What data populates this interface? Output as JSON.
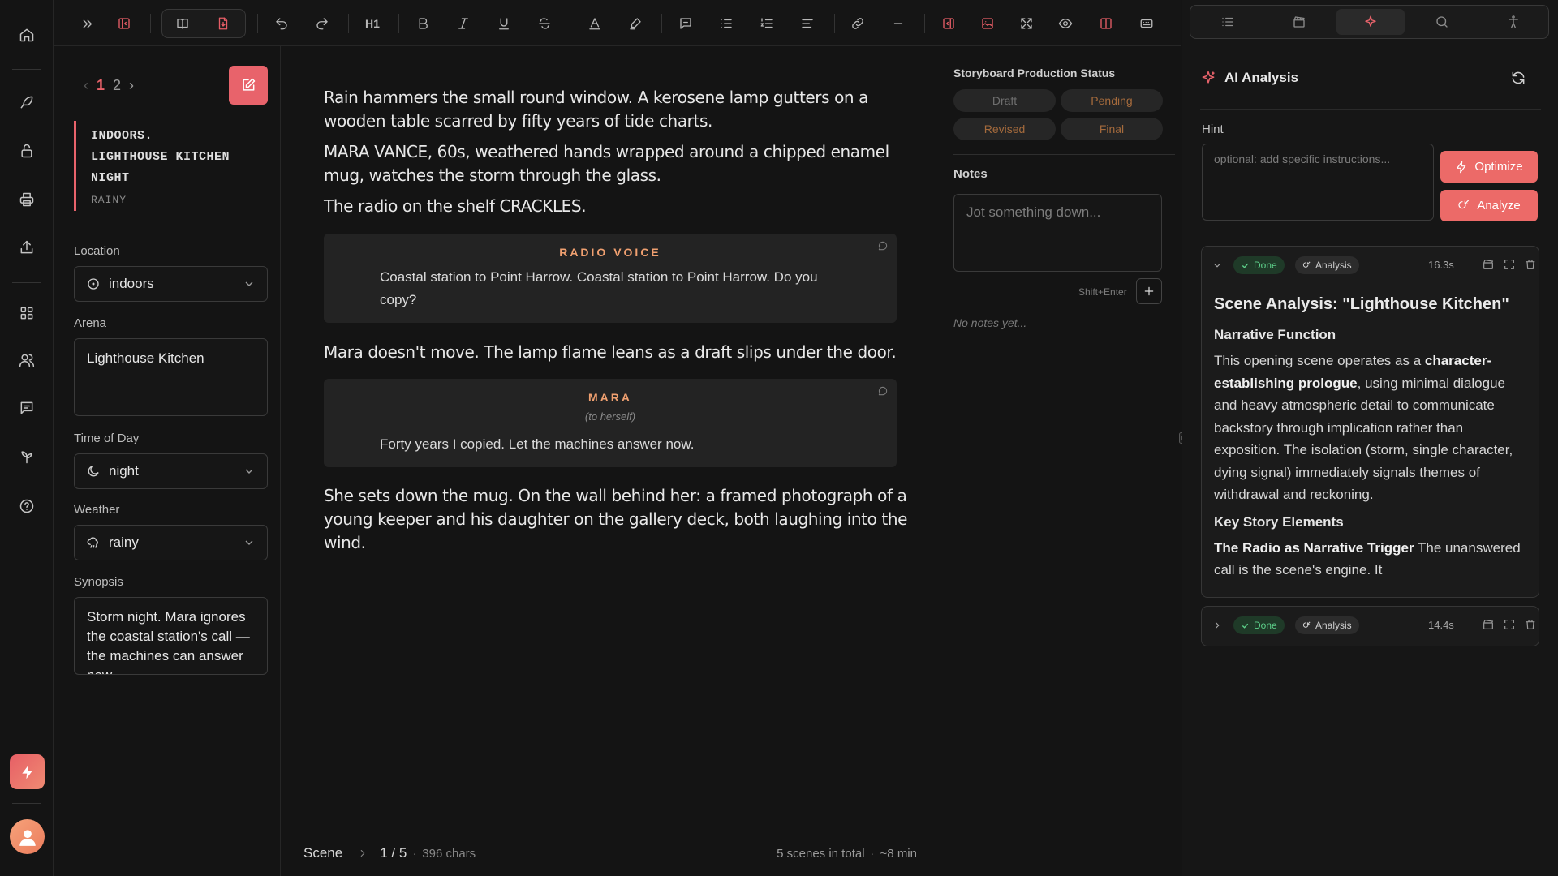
{
  "rail": {
    "items": [
      {
        "icon": "home-icon"
      },
      {
        "icon": "feather-icon"
      },
      {
        "icon": "lock-icon"
      },
      {
        "icon": "printer-icon"
      },
      {
        "icon": "share-icon"
      },
      {
        "icon": "grid-icon"
      },
      {
        "icon": "users-icon"
      },
      {
        "icon": "message-icon"
      },
      {
        "icon": "sprout-icon"
      },
      {
        "icon": "help-icon"
      }
    ],
    "quick_action_icon": "bolt-icon",
    "avatar_icon": "user-avatar-icon"
  },
  "toolbar": {
    "heading_label": "H1",
    "icons": [
      "expand-icon",
      "sidebar-toggle-icon",
      "book-icon",
      "file-icon",
      "undo-icon",
      "redo-icon",
      "h1-icon",
      "bold-icon",
      "italic-icon",
      "underline-icon",
      "strikethrough-icon",
      "text-color-icon",
      "highlighter-icon",
      "comment-icon",
      "bullet-list-icon",
      "numbered-list-icon",
      "align-icon",
      "link-icon",
      "divider-icon",
      "panel-left-icon",
      "image-icon",
      "fullscreen-icon",
      "preview-icon",
      "split-view-icon",
      "keyboard-icon"
    ]
  },
  "scene_nav": {
    "pages": [
      "1",
      "2"
    ],
    "current_page": "1"
  },
  "scene_heading": {
    "lines": [
      "INDOORS.",
      "LIGHTHOUSE KITCHEN",
      "NIGHT"
    ],
    "weather": "RAINY"
  },
  "fields": {
    "location": {
      "label": "Location",
      "value": "indoors"
    },
    "arena": {
      "label": "Arena",
      "value": "Lighthouse Kitchen"
    },
    "time_of_day": {
      "label": "Time of Day",
      "value": "night"
    },
    "weather": {
      "label": "Weather",
      "value": "rainy"
    },
    "synopsis": {
      "label": "Synopsis",
      "value": "Storm night. Mara ignores the coastal station's call — the machines can answer now."
    }
  },
  "script": {
    "p1": "Rain hammers the small round window. A kerosene lamp gutters on a wooden table scarred by fifty years of tide charts.",
    "p2": "MARA VANCE, 60s, weathered hands wrapped around a chipped enamel mug, watches the storm through the glass.",
    "p3": "The radio on the shelf CRACKLES.",
    "d1": {
      "character": "RADIO VOICE",
      "line": "Coastal station to Point Harrow. Coastal station to Point Harrow. Do you copy?"
    },
    "p4": "Mara doesn't move. The lamp flame leans as a draft slips under the door.",
    "d2": {
      "character": "MARA",
      "parenthetical": "(to herself)",
      "line": "Forty years I copied. Let the machines answer now."
    },
    "p5": "She sets down the mug. On the wall behind her: a framed photograph of a young keeper and his daughter on the gallery deck, both laughing into the wind."
  },
  "editor_footer": {
    "type_label": "Scene",
    "position": "1 / 5",
    "chars": "396 chars",
    "total": "5 scenes in total",
    "duration": "~8 min"
  },
  "status": {
    "title": "Storyboard Production Status",
    "options": [
      {
        "label": "Draft",
        "color": "#6e6e6e"
      },
      {
        "label": "Pending",
        "color": "#a46a3c"
      },
      {
        "label": "Revised",
        "color": "#a46a3c"
      },
      {
        "label": "Final",
        "color": "#a46a3c"
      }
    ]
  },
  "notes": {
    "title": "Notes",
    "placeholder": "Jot something down...",
    "hint": "Shift+Enter",
    "empty": "No notes yet..."
  },
  "right_panel": {
    "tabs": [
      {
        "icon": "list-icon"
      },
      {
        "icon": "clapperboard-icon"
      },
      {
        "icon": "sparkle-icon",
        "active": true
      },
      {
        "icon": "search-icon"
      },
      {
        "icon": "accessibility-icon"
      }
    ],
    "title": "AI Analysis",
    "hint_label": "Hint",
    "hint_placeholder": "optional: add specific instructions...",
    "optimize_label": "Optimize",
    "analyze_label": "Analyze",
    "accent": "#ec6a68"
  },
  "analyses": [
    {
      "status": "Done",
      "type": "Analysis",
      "time": "16.3s",
      "expanded": true,
      "title": "Scene Analysis: \"Lighthouse Kitchen\"",
      "section1": "Narrative Function",
      "body1_pre": "This opening scene operates as a ",
      "body1_bold": "character-establishing prologue",
      "body1_post": ", using minimal dialogue and heavy atmospheric detail to communicate backstory through implication rather than exposition. The isolation (storm, single character, dying signal) immediately signals themes of withdrawal and reckoning.",
      "section2": "Key Story Elements",
      "body2_bold": "The Radio as Narrative Trigger",
      "body2_post": " The unanswered call is the scene's engine. It"
    },
    {
      "status": "Done",
      "type": "Analysis",
      "time": "14.4s",
      "expanded": false
    }
  ]
}
